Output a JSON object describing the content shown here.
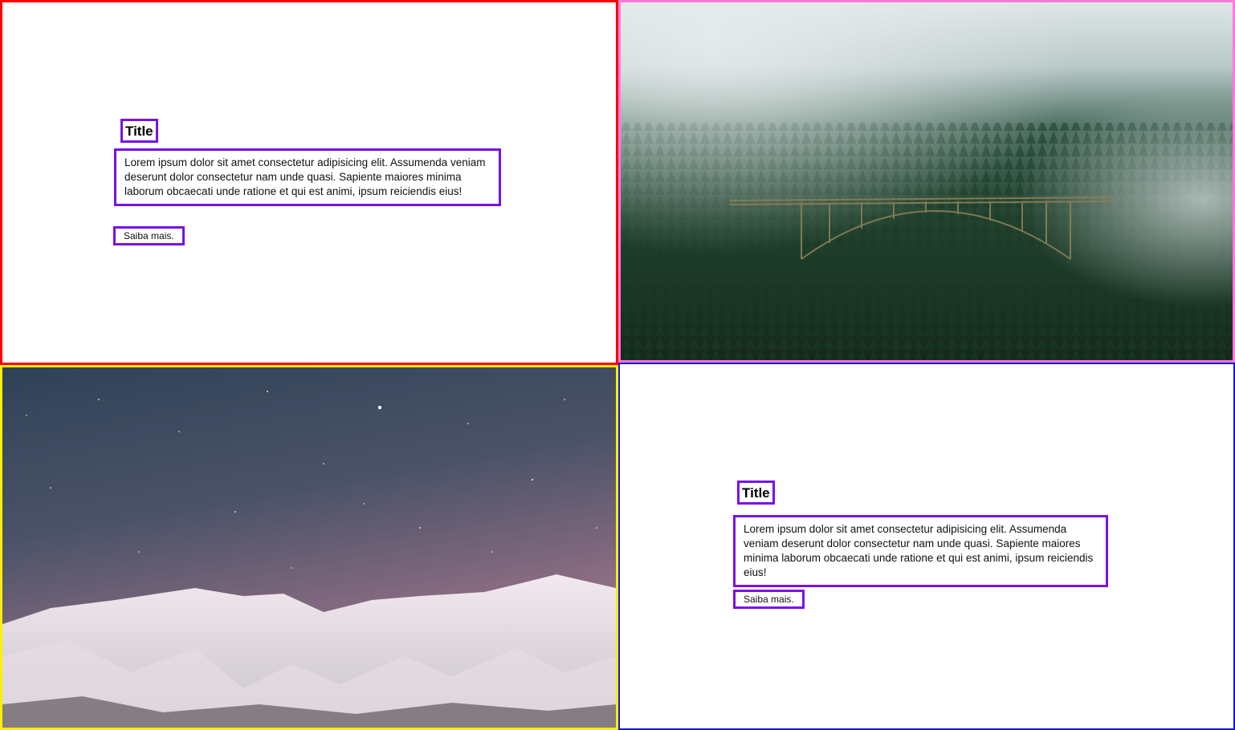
{
  "sections": [
    {
      "title": "Title",
      "text": "Lorem ipsum dolor sit amet consectetur adipisicing elit. Assumenda veniam deserunt dolor consectetur nam unde quasi. Sapiente maiores minima laborum obcaecati unde ratione et qui est animi, ipsum reiciendis eius!",
      "link": "Saiba mais."
    },
    {
      "title": "Title",
      "text": "Lorem ipsum dolor sit amet consectetur adipisicing elit. Assumenda veniam deserunt dolor consectetur nam unde quasi. Sapiente maiores minima laborum obcaecati unde ratione et qui est animi, ipsum reiciendis eius!",
      "link": "Saiba mais."
    }
  ],
  "images": [
    {
      "name": "forest-bridge-photo"
    },
    {
      "name": "snowy-mountain-night-sky-photo"
    }
  ],
  "colors": {
    "outline_red": "#ff0000",
    "outline_pink": "#ff7ad9",
    "outline_yellow": "#ffee00",
    "outline_blue": "#1414d6",
    "outline_purple": "#7a12e6"
  }
}
